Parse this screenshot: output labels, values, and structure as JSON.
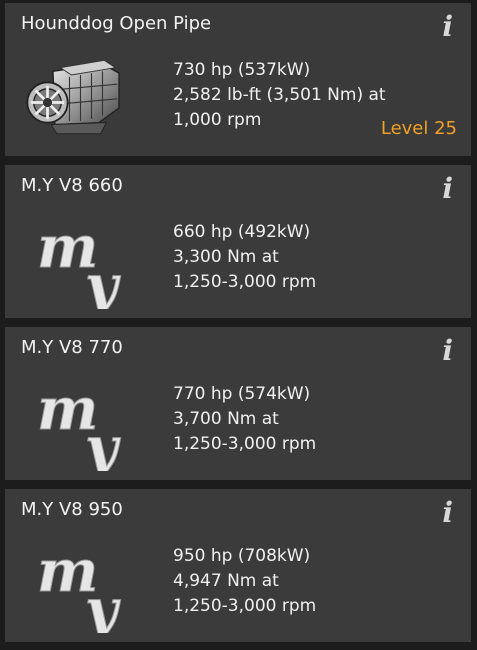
{
  "engines": [
    {
      "name": "Hounddog Open Pipe",
      "logo": "engine-icon",
      "lines": [
        "730 hp (537kW)",
        "2,582 lb-ft (3,501 Nm) at",
        "1,000 rpm"
      ],
      "level": "Level 25"
    },
    {
      "name": "M.Y V8 660",
      "logo": "my-brand-logo",
      "lines": [
        "660 hp (492kW)",
        "3,300 Nm at",
        "1,250-3,000 rpm"
      ]
    },
    {
      "name": "M.Y V8 770",
      "logo": "my-brand-logo",
      "lines": [
        "770 hp (574kW)",
        "3,700 Nm at",
        "1,250-3,000 rpm"
      ]
    },
    {
      "name": "M.Y V8 950",
      "logo": "my-brand-logo",
      "lines": [
        "950 hp (708kW)",
        "4,947 Nm at",
        "1,250-3,000 rpm"
      ]
    }
  ],
  "ui": {
    "info_glyph": "i",
    "accent_color": "#f0a024"
  }
}
